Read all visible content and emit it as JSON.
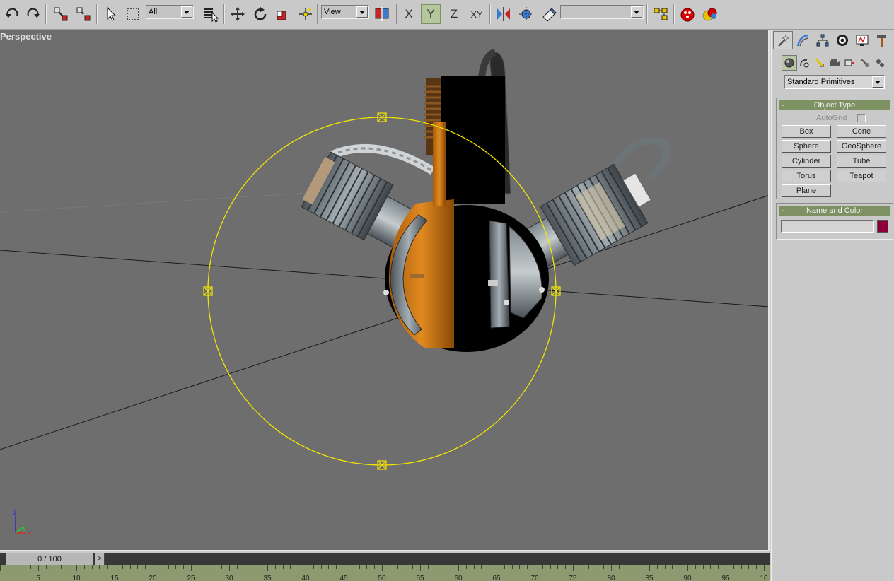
{
  "toolbar": {
    "selection_filter": "All",
    "reference_coord": "View",
    "named_selection": "",
    "axis_x": "X",
    "axis_y": "Y",
    "axis_z": "Z",
    "axis_xy": "XY",
    "active_axis": "Y"
  },
  "viewport": {
    "label": "Perspective",
    "tripod": {
      "z": "z",
      "y": "y",
      "x": "x"
    }
  },
  "command_panel": {
    "category": "Standard Primitives",
    "object_type": {
      "title": "Object Type",
      "collapse": "-",
      "autogrid_label": "AutoGrid",
      "buttons": [
        "Box",
        "Cone",
        "Sphere",
        "GeoSphere",
        "Cylinder",
        "Tube",
        "Torus",
        "Teapot",
        "Plane"
      ]
    },
    "name_and_color": {
      "title": "Name and Color",
      "collapse": "-",
      "name_value": "",
      "color": "#8a0038"
    }
  },
  "timeline": {
    "frame_display": "0 / 100",
    "next_label": ">",
    "ticks": [
      "5",
      "10",
      "15",
      "20",
      "25",
      "30",
      "35",
      "40",
      "45",
      "50",
      "55",
      "60",
      "65",
      "70",
      "75",
      "80",
      "85",
      "90",
      "95",
      "10"
    ]
  },
  "colors": {
    "viewport_bg": "#6e6e6e",
    "selection_gizmo": "#f2e600",
    "rollout_header": "#7d9162",
    "trackbar": "#8d9a70"
  }
}
